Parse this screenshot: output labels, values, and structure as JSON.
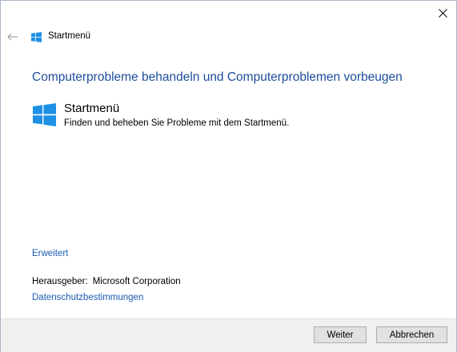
{
  "window": {
    "title": "Startmenü"
  },
  "header": {
    "heading": "Computerprobleme behandeln und Computerproblemen vorbeugen"
  },
  "item": {
    "title": "Startmenü",
    "description": "Finden und beheben Sie Probleme mit dem Startmenü."
  },
  "links": {
    "advanced": "Erweitert",
    "privacy": "Datenschutzbestimmungen"
  },
  "publisher": {
    "label": "Herausgeber:",
    "value": "Microsoft Corporation"
  },
  "buttons": {
    "next": "Weiter",
    "cancel": "Abbrechen"
  },
  "icons": {
    "close": "close-icon",
    "back": "back-arrow-icon",
    "logo": "windows-logo-icon"
  },
  "colors": {
    "heading": "#1e4e9c",
    "link": "#1a5bb4",
    "windows_logo": "#1e90e6",
    "footer_bg": "#f0f0f0"
  }
}
